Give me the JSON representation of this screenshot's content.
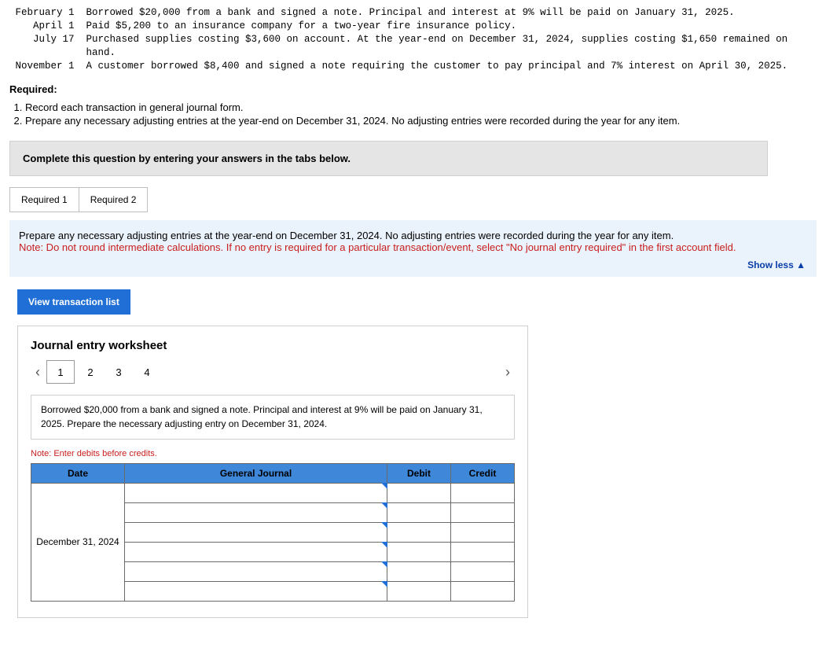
{
  "transactions": {
    "feb1": " February 1  Borrowed $20,000 from a bank and signed a note. Principal and interest at 9% will be paid on January 31, 2025.",
    "apr1": "    April 1  Paid $5,200 to an insurance company for a two-year fire insurance policy.",
    "jul17a": "    July 17  Purchased supplies costing $3,600 on account. At the year-end on December 31, 2024, supplies costing $1,650 remained on",
    "jul17b": "             hand.",
    "nov1": " November 1  A customer borrowed $8,400 and signed a note requiring the customer to pay principal and 7% interest on April 30, 2025."
  },
  "required_heading": "Required:",
  "req1": "Record each transaction in general journal form.",
  "req2": "Prepare any necessary adjusting entries at the year-end on December 31, 2024. No adjusting entries were recorded during the year for any item.",
  "gray_bar": "Complete this question by entering your answers in the tabs below.",
  "tabs": {
    "t1": "Required 1",
    "t2": "Required 2"
  },
  "panel": {
    "line1": "Prepare any necessary adjusting entries at the year-end on December 31, 2024. No adjusting entries were recorded during the year for any item.",
    "line2": "Note: Do not round intermediate calculations. If no entry is required for a particular transaction/event, select \"No journal entry required\" in the first account field.",
    "show_less": "Show less"
  },
  "btn_view": "View transaction list",
  "worksheet": {
    "title": "Journal entry worksheet",
    "pages": {
      "p1": "1",
      "p2": "2",
      "p3": "3",
      "p4": "4"
    },
    "desc": "Borrowed $20,000 from a bank and signed a note. Principal and interest at 9% will be paid on January 31, 2025. Prepare the necessary adjusting entry on December 31, 2024.",
    "note": "Note: Enter debits before credits.",
    "headers": {
      "date": "Date",
      "gj": "General Journal",
      "debit": "Debit",
      "credit": "Credit"
    },
    "date_value": "December 31, 2024"
  }
}
